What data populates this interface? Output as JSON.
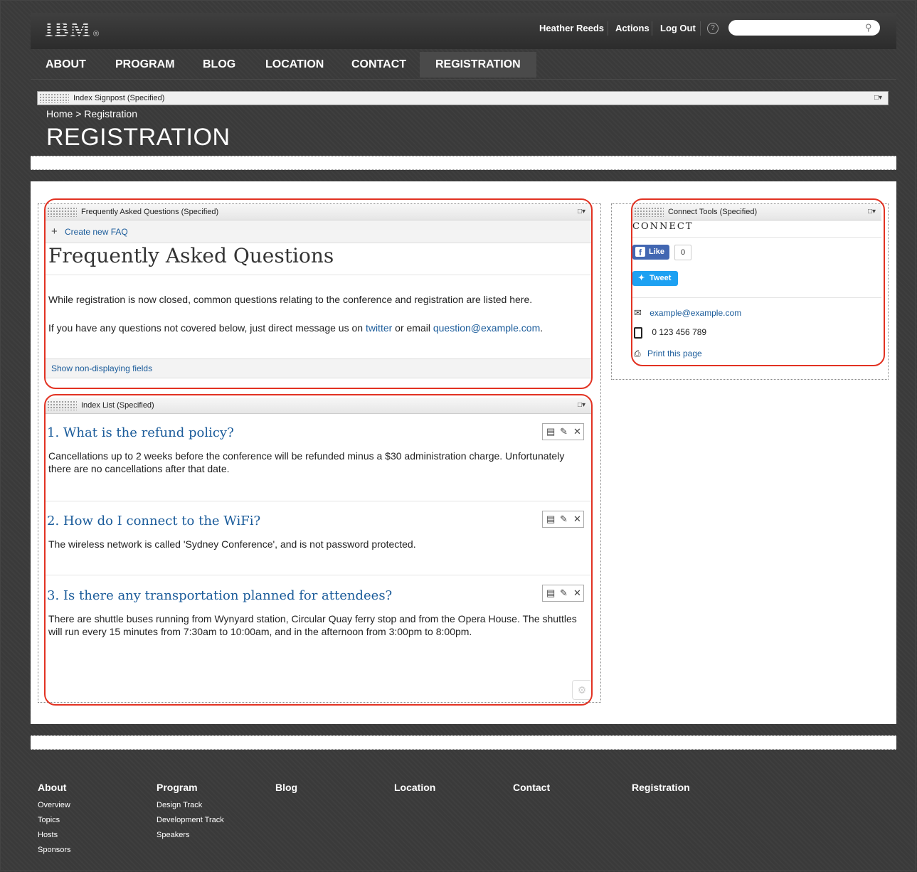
{
  "header": {
    "logo": "IBM",
    "user_name": "Heather Reeds",
    "actions_label": "Actions",
    "logout_label": "Log Out",
    "help_glyph": "?",
    "search_placeholder": "",
    "icons": [
      "help-icon",
      "search-icon"
    ]
  },
  "nav": {
    "items": [
      {
        "label": "ABOUT"
      },
      {
        "label": "PROGRAM"
      },
      {
        "label": "BLOG"
      },
      {
        "label": "LOCATION"
      },
      {
        "label": "CONTACT"
      },
      {
        "label": "REGISTRATION",
        "active": true
      }
    ]
  },
  "signpost": {
    "bar_title": "Index Signpost (Specified)",
    "breadcrumb": "Home > Registration",
    "page_title": "REGISTRATION"
  },
  "faq": {
    "bar_title": "Frequently Asked Questions (Specified)",
    "create_label": "Create new FAQ",
    "heading": "Frequently Asked Questions",
    "intro": "While registration is now closed, common questions relating to the conference and registration are listed here.",
    "contact_prefix": "If you have any questions not covered below, just direct message us on",
    "twitter_link": "twitter",
    "or_email": "or email",
    "email_link": "question@example.com",
    "period": ".",
    "show_fields_label": "Show non-displaying fields"
  },
  "index_list": {
    "bar_title": "Index List (Specified)",
    "questions": [
      {
        "number": "1.",
        "title": "What is the refund policy?",
        "answer": "Cancellations up to 2 weeks before the conference will be refunded minus a $30 administration charge. Unfortunately there are no cancellations after that date."
      },
      {
        "number": "2.",
        "title": "How do I connect to the WiFi?",
        "answer": "The wireless network is called 'Sydney Conference', and is not password protected."
      },
      {
        "number": "3.",
        "title": "Is there any transportation planned for attendees?",
        "answer": "There are shuttle buses running from Wynyard station, Circular Quay ferry stop and from the Opera House. The shuttles will run every 15 minutes from 7:30am to 10:00am, and in the afternoon from 3:00pm to 8:00pm."
      }
    ]
  },
  "connect": {
    "bar_title": "Connect Tools (Specified)",
    "heading": "CONNECT",
    "like_label": "Like",
    "like_count": "0",
    "tweet_label": "Tweet",
    "email": "example@example.com",
    "phone": "0 123 456 789",
    "print_label": "Print this page"
  },
  "footer": {
    "columns": [
      {
        "title": "About",
        "links": [
          "Overview",
          "Topics",
          "Hosts",
          "Sponsors"
        ]
      },
      {
        "title": "Program",
        "links": [
          "Design Track",
          "Development Track",
          "Speakers"
        ]
      },
      {
        "title": "Blog",
        "links": []
      },
      {
        "title": "Location",
        "links": []
      },
      {
        "title": "Contact",
        "links": []
      },
      {
        "title": "Registration",
        "links": []
      }
    ]
  },
  "colors": {
    "highlight_ring": "#e23222",
    "link": "#1a5b9a",
    "facebook": "#4267b2",
    "twitter": "#1da1f2"
  }
}
